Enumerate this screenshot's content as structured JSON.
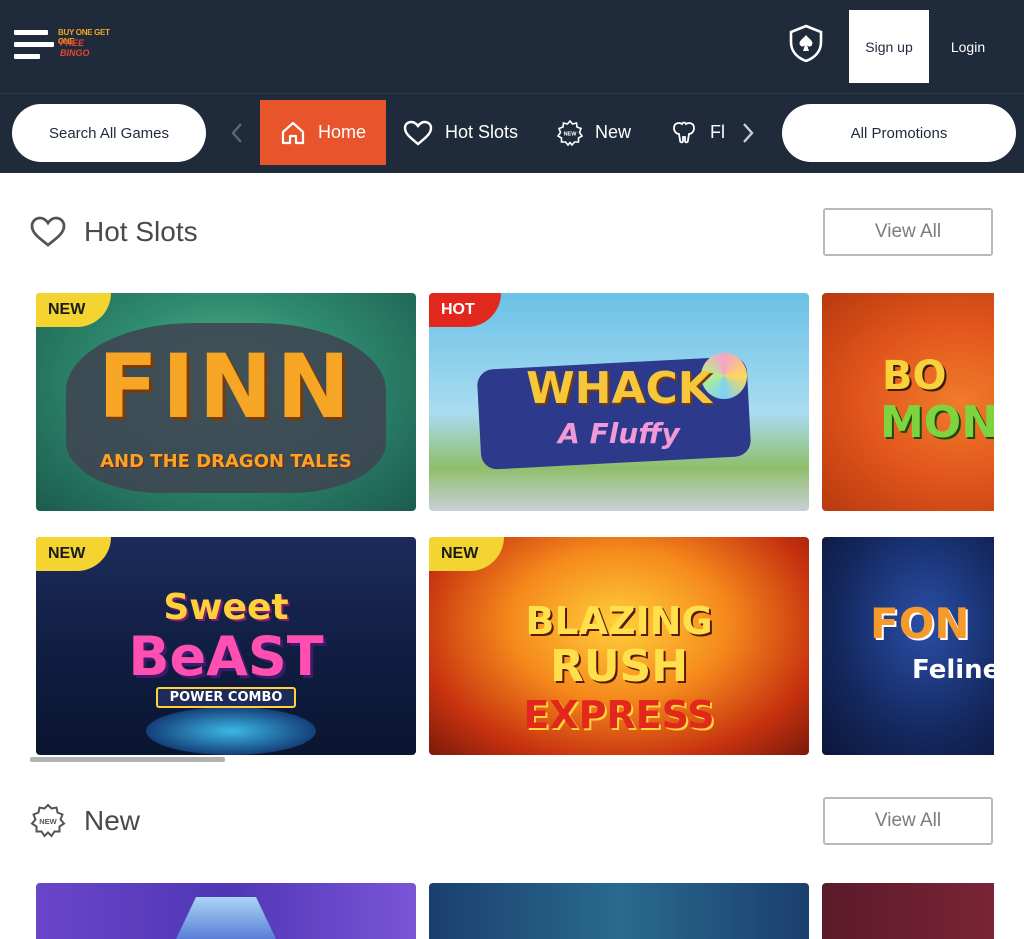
{
  "header": {
    "logo_line1": "BUY ONE GET ONE",
    "logo_line2": "FREE BINGO",
    "signup_label": "Sign up",
    "login_label": "Login"
  },
  "nav": {
    "search_label": "Search All Games",
    "promotions_label": "All Promotions",
    "items": [
      {
        "label": "Home",
        "icon": "home-icon",
        "active": true
      },
      {
        "label": "Hot Slots",
        "icon": "heart-icon"
      },
      {
        "label": "New",
        "icon": "new-badge-icon"
      },
      {
        "label": "Fl",
        "icon": "elephant-icon"
      }
    ]
  },
  "sections": [
    {
      "title": "Hot Slots",
      "view_all": "View All",
      "games": [
        {
          "title_line1": "FINN",
          "title_line2": "AND THE DRAGON TALES",
          "badge": "NEW"
        },
        {
          "title_line1": "WHACK",
          "title_line2": "A Fluffy",
          "badge": "HOT"
        },
        {
          "title_line1": "BO",
          "title_line2": "MON",
          "badge": ""
        },
        {
          "title_line1": "Sweet",
          "title_line2": "BeAST",
          "title_line3": "POWER COMBO",
          "badge": "NEW"
        },
        {
          "title_line1": "BLAZING",
          "title_line2": "RUSH",
          "title_line3": "EXPRESS",
          "badge": "NEW"
        },
        {
          "title_line1": "FON",
          "title_line2": "Feline",
          "badge": ""
        }
      ]
    },
    {
      "title": "New",
      "view_all": "View All"
    }
  ],
  "colors": {
    "header_bg": "#1f2a3b",
    "accent_orange": "#e8542c",
    "badge_new": "#f3d431",
    "badge_hot": "#e2271c"
  }
}
